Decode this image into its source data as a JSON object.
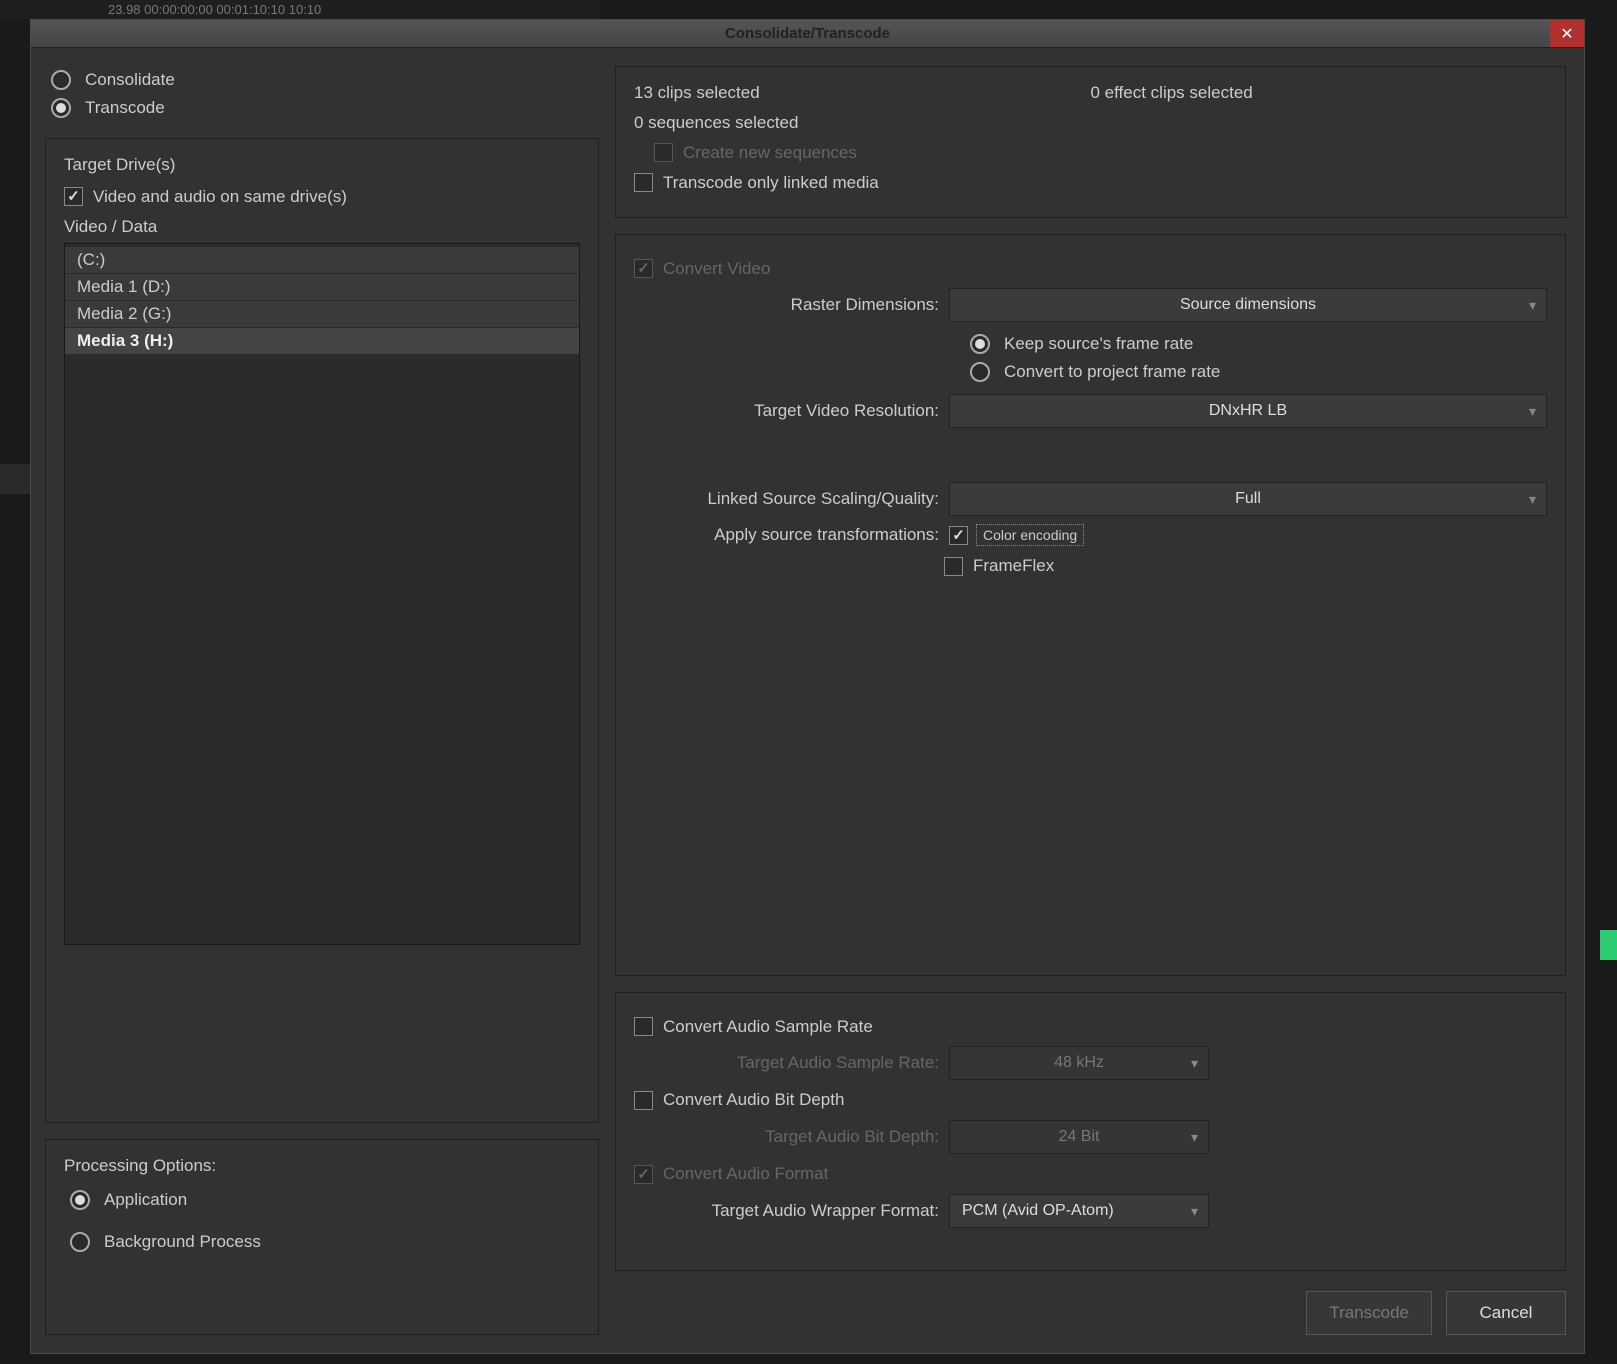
{
  "titlebar": {
    "title": "Consolidate/Transcode"
  },
  "background": {
    "timecode_fragment": "23.98   00:00:00:00   00:01:10:10            10:10"
  },
  "mode": {
    "consolidate": "Consolidate",
    "transcode": "Transcode"
  },
  "drives": {
    "heading": "Target Drive(s)",
    "same_drive": "Video and audio on same drive(s)",
    "video_data": "Video / Data",
    "list": [
      {
        "label": "(C:)",
        "selected": false
      },
      {
        "label": "Media 1 (D:)",
        "selected": false
      },
      {
        "label": "Media 2 (G:)",
        "selected": false
      },
      {
        "label": "Media 3 (H:)",
        "selected": true
      }
    ]
  },
  "processing": {
    "heading": "Processing Options:",
    "application": "Application",
    "background": "Background Process"
  },
  "selection": {
    "clips": "13 clips selected",
    "effect_clips": "0 effect clips selected",
    "sequences": "0 sequences selected",
    "create_new_sequences": "Create new sequences",
    "transcode_linked_only": "Transcode only linked media"
  },
  "video": {
    "convert": "Convert Video",
    "raster_label": "Raster Dimensions:",
    "raster_value": "Source dimensions",
    "keep_fps": "Keep source's frame rate",
    "convert_fps": "Convert to project frame rate",
    "target_res_label": "Target Video Resolution:",
    "target_res_value": "DNxHR LB",
    "scaling_label": "Linked Source Scaling/Quality:",
    "scaling_value": "Full",
    "apply_src_label": "Apply source transformations:",
    "color_encoding": "Color encoding",
    "frameflex": "FrameFlex"
  },
  "audio": {
    "convert_sr": "Convert Audio Sample Rate",
    "sr_label": "Target Audio Sample Rate:",
    "sr_value": "48 kHz",
    "convert_bd": "Convert Audio Bit Depth",
    "bd_label": "Target Audio Bit Depth:",
    "bd_value": "24 Bit",
    "convert_fmt": "Convert Audio Format",
    "wrapper_label": "Target Audio Wrapper Format:",
    "wrapper_value": "PCM  (Avid OP-Atom)"
  },
  "buttons": {
    "transcode": "Transcode",
    "cancel": "Cancel"
  }
}
